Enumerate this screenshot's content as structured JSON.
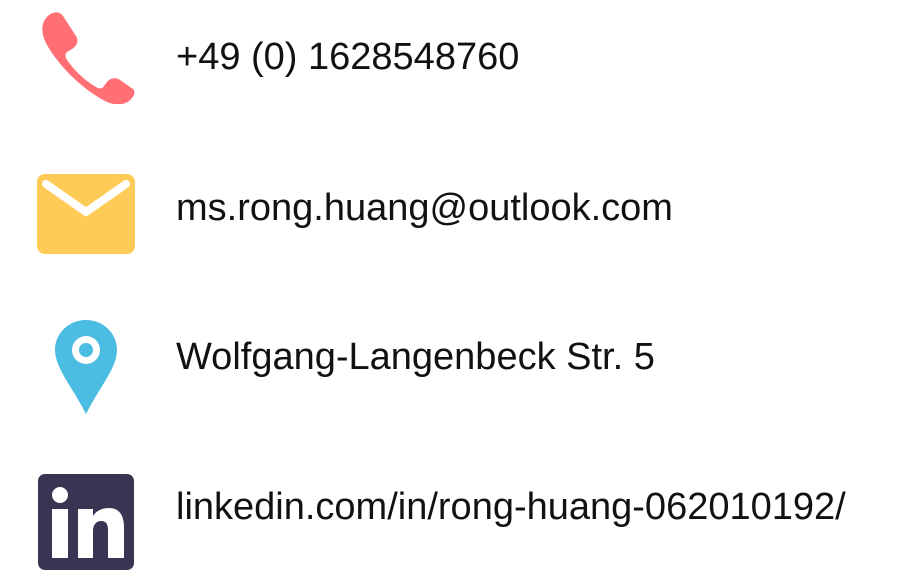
{
  "contacts": {
    "phone": {
      "icon": "phone-icon",
      "icon_color": "#FF6F73",
      "text": "+49 (0) 1628548760"
    },
    "email": {
      "icon": "envelope-icon",
      "icon_color": "#FFCB57",
      "text": "ms.rong.huang@outlook.com"
    },
    "location": {
      "icon": "map-pin-icon",
      "icon_color": "#4BBDE3",
      "text": "Wolfgang-Langenbeck Str. 5"
    },
    "linkedin": {
      "icon": "linkedin-icon",
      "icon_color": "#373551",
      "text": "linkedin.com/in/rong-huang-062010192/"
    }
  }
}
